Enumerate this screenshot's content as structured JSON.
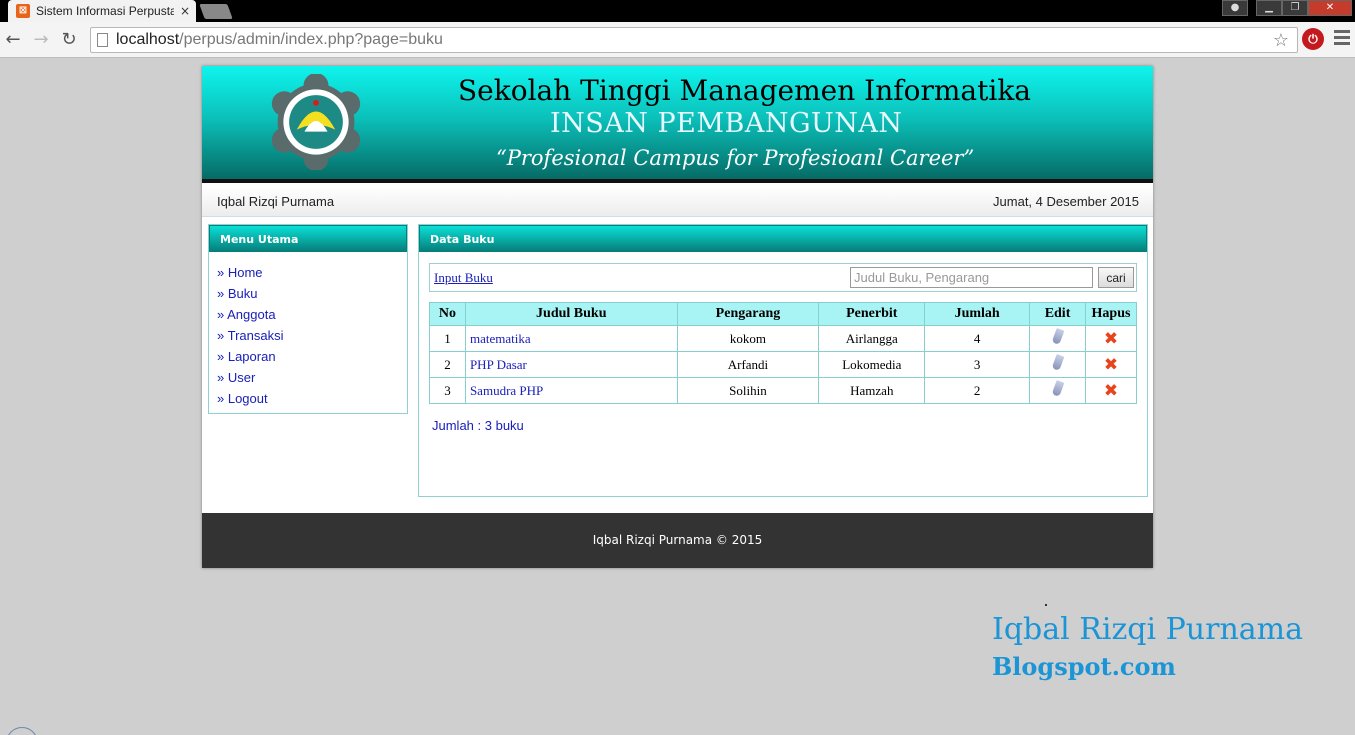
{
  "browser": {
    "tab_title": "Sistem Informasi Perpusta",
    "tab_close": "×",
    "url_host": "localhost",
    "url_path": "/perpus/admin/index.php?page=buku",
    "ext_label": "⏻"
  },
  "banner": {
    "line1": "Sekolah Tinggi Managemen Informatika",
    "line2": "INSAN PEMBANGUNAN",
    "line3": "“Profesional Campus for Profesioanl Career”"
  },
  "infobar": {
    "user": "Iqbal Rizqi Purnama",
    "date": "Jumat, 4 Desember 2015"
  },
  "sidebar": {
    "title": "Menu Utama",
    "items": [
      "» Home",
      "» Buku",
      "» Anggota",
      "» Transaksi",
      "» Laporan",
      "» User",
      "» Logout"
    ]
  },
  "content": {
    "title": "Data Buku",
    "input_link": "Input Buku",
    "search_placeholder": "Judul Buku, Pengarang",
    "search_button": "cari",
    "columns": [
      "No",
      "Judul Buku",
      "Pengarang",
      "Penerbit",
      "Jumlah",
      "Edit",
      "Hapus"
    ],
    "rows": [
      {
        "no": "1",
        "judul": "matematika",
        "pengarang": "kokom",
        "penerbit": "Airlangga",
        "jumlah": "4"
      },
      {
        "no": "2",
        "judul": "PHP Dasar",
        "pengarang": "Arfandi",
        "penerbit": "Lokomedia",
        "jumlah": "3"
      },
      {
        "no": "3",
        "judul": "Samudra PHP",
        "pengarang": "Solihin",
        "penerbit": "Hamzah",
        "jumlah": "2"
      }
    ],
    "count": "Jumlah : 3 buku",
    "delete_glyph": "✖"
  },
  "footer": {
    "text": "Iqbal Rizqi Purnama © 2015"
  },
  "watermark": {
    "line1": "Iqbal Rizqi Purnama",
    "line2": "Blogspot.com"
  },
  "colors": {
    "accent": "#0bc2bb",
    "link": "#1a20b8",
    "footer": "#333333",
    "watermark": "#1b95d6"
  }
}
